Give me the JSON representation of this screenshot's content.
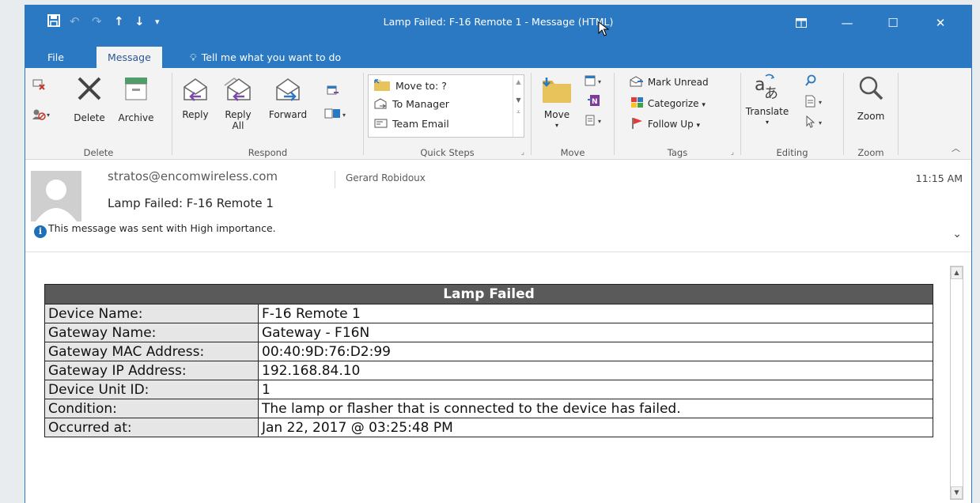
{
  "window": {
    "title": "Lamp Failed: F-16 Remote 1  -  Message (HTML)"
  },
  "tabs": {
    "file": "File",
    "message": "Message",
    "tell_me": "Tell me what you want to do"
  },
  "ribbon": {
    "delete_group": {
      "label": "Delete",
      "delete": "Delete",
      "archive": "Archive"
    },
    "respond_group": {
      "label": "Respond",
      "reply": "Reply",
      "reply_all_1": "Reply",
      "reply_all_2": "All",
      "forward": "Forward"
    },
    "quick_steps_group": {
      "label": "Quick Steps",
      "items": [
        "Move to: ?",
        "To Manager",
        "Team Email"
      ]
    },
    "move_group": {
      "label": "Move",
      "move": "Move"
    },
    "tags_group": {
      "label": "Tags",
      "mark_unread": "Mark Unread",
      "categorize": "Categorize",
      "follow_up": "Follow Up"
    },
    "editing_group": {
      "label": "Editing",
      "translate": "Translate"
    },
    "zoom_group": {
      "label": "Zoom",
      "zoom": "Zoom"
    }
  },
  "message": {
    "from": "stratos@encomwireless.com",
    "to": "Gerard Robidoux",
    "time": "11:15 AM",
    "subject": "Lamp Failed: F-16 Remote 1",
    "importance_note": "This message was sent with High importance."
  },
  "table": {
    "title": "Lamp Failed",
    "rows": [
      {
        "key": "Device Name:",
        "value": "F-16 Remote 1"
      },
      {
        "key": "Gateway Name:",
        "value": "Gateway - F16N"
      },
      {
        "key": "Gateway MAC Address:",
        "value": "00:40:9D:76:D2:99"
      },
      {
        "key": "Gateway IP Address:",
        "value": "192.168.84.10"
      },
      {
        "key": "Device Unit ID:",
        "value": "1"
      },
      {
        "key": "Condition:",
        "value": "The lamp or flasher that is connected to the device has failed."
      },
      {
        "key": "Occurred at:",
        "value": "Jan 22, 2017 @ 03:25:48 PM"
      }
    ]
  },
  "colors": {
    "accent": "#2b79c2",
    "ribbon_bg": "#f3f3f3",
    "table_header": "#5a5a5a",
    "key_cell": "#e6e6e6"
  }
}
